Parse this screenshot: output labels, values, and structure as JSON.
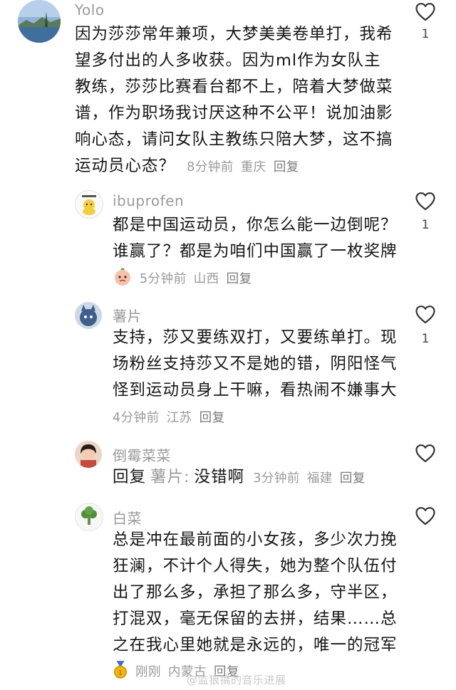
{
  "comments": [
    {
      "username": "Yolo",
      "avatar": "lake-landscape-avatar",
      "lines": [
        "因为莎莎常年兼项，大梦美美卷单打，我希",
        "望多付出的人多收获。因为ml作为女队主",
        "教练，莎莎比赛看台都不上，陪着大梦做菜",
        "谱，作为职场我讨厌这种不公平！说加油影",
        "响心态，请问女队主教练只陪大梦，这不搞",
        "运动员心态？"
      ],
      "time": "8分钟前",
      "location": "重庆",
      "reply_label": "回复",
      "likes": "1"
    },
    {
      "username": "ibuprofen",
      "avatar": "yellow-duck-avatar",
      "lines": [
        "都是中国运动员，你怎么能一边倒呢？",
        "谁赢了？都是为咱们中国赢了一枚奖牌"
      ],
      "sticker": "crying-bun-sticker",
      "time": "5分钟前",
      "location": "山西",
      "reply_label": "回复",
      "likes": "1"
    },
    {
      "username": "薯片",
      "avatar": "blue-cat-avatar",
      "lines": [
        "支持，莎又要练双打，又要练单打。现",
        "场粉丝支持莎又不是她的错，阴阳怪气",
        "怪到运动员身上干嘛，看热闹不嫌事大"
      ],
      "time": "4分钟前",
      "location": "江苏",
      "reply_label": "回复",
      "likes": "1"
    },
    {
      "username": "倒霉菜菜",
      "avatar": "girl-photo-avatar",
      "reply_prefix": "回复",
      "reply_target": "薯片:",
      "lines": [
        "没错啊"
      ],
      "time": "3分钟前",
      "location": "福建",
      "reply_label": "回复",
      "likes": ""
    },
    {
      "username": "白菜",
      "avatar": "cabbage-avatar",
      "lines": [
        "总是冲在最前面的小女孩，多少次力挽",
        "狂澜，不计个人得失，她为整个队伍付",
        "出了那么多，承担了那么多，守半区，",
        "打混双，毫无保留的去拼，结果……总",
        "之在我心里她就是永远的，唯一的冠军"
      ],
      "sticker": "gold-medal-sticker",
      "time": "刚刚",
      "location": "内蒙古",
      "reply_label": "回复",
      "likes": ""
    }
  ],
  "watermark": "@监狼搞的音乐进展",
  "colors": {
    "text": "#161616",
    "muted": "#9a9a9a",
    "icon": "#333333"
  }
}
